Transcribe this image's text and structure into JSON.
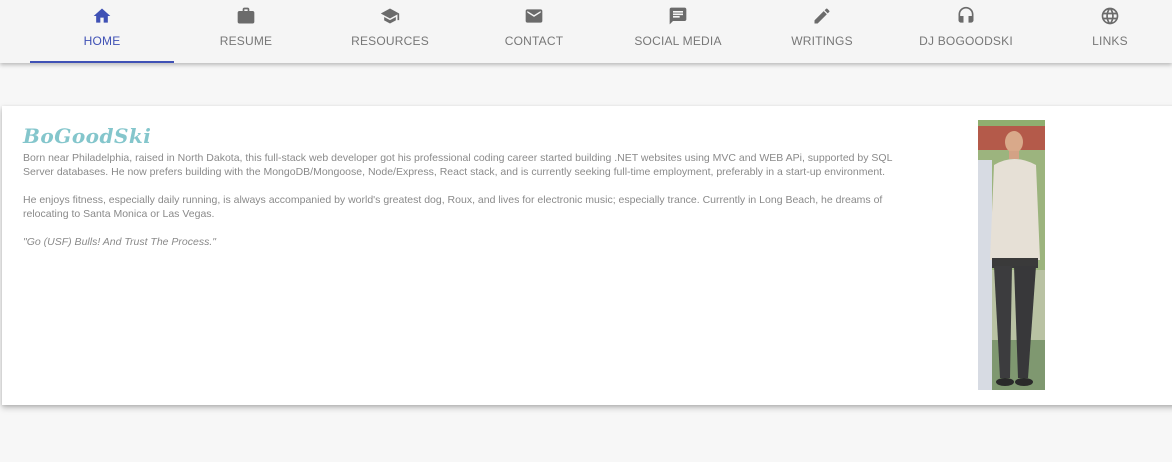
{
  "nav": {
    "tabs": [
      {
        "label": "HOME",
        "icon": "home-icon",
        "active": true
      },
      {
        "label": "RESUME",
        "icon": "briefcase-icon",
        "active": false
      },
      {
        "label": "RESOURCES",
        "icon": "graduation-cap-icon",
        "active": false
      },
      {
        "label": "CONTACT",
        "icon": "mail-icon",
        "active": false
      },
      {
        "label": "SOCIAL MEDIA",
        "icon": "chat-icon",
        "active": false
      },
      {
        "label": "WRITINGS",
        "icon": "pencil-icon",
        "active": false
      },
      {
        "label": "DJ BOGOODSKI",
        "icon": "headphones-icon",
        "active": false
      },
      {
        "label": "LINKS",
        "icon": "globe-icon",
        "active": false
      }
    ],
    "accent_color": "#3f51b5"
  },
  "profile": {
    "title": "BoGoodSki",
    "title_color": "#84c6cc",
    "paragraphs": [
      "Born near Philadelphia, raised in North Dakota, this full-stack web developer got his professional coding career started building .NET websites using MVC and WEB APi, supported by SQL Server databases. He now prefers building with the MongoDB/Mongoose, Node/Express, React stack, and is currently seeking full-time employment, preferably in a start-up environment.",
      "He enjoys fitness, especially daily running, is always accompanied by world's greatest dog, Roux, and lives for electronic music; especially trance. Currently in Long Beach, he dreams of relocating to Santa Monica or Las Vegas."
    ],
    "quote": "\"Go (USF) Bulls! And Trust The Process.\""
  }
}
